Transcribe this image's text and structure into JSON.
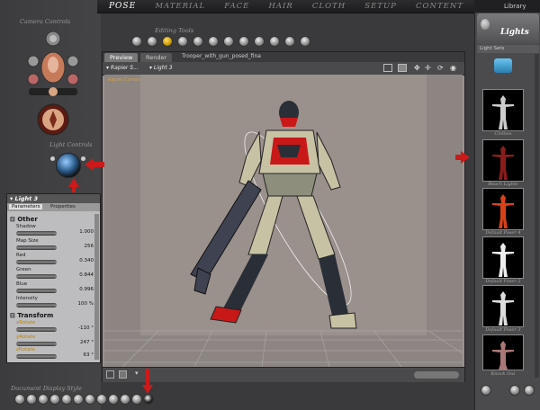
{
  "top_tabs": [
    "POSE",
    "MATERIAL",
    "FACE",
    "HAIR",
    "CLOTH",
    "SETUP",
    "CONTENT"
  ],
  "left": {
    "camera_controls_label": "Camera Controls",
    "light_controls_label": "Light Controls",
    "display_style_label": "Document Display Style"
  },
  "editing_tools_label": "Editing Tools",
  "document": {
    "tabs": [
      "Preview",
      "Render"
    ],
    "filename": "Trooper_with_gun_posed_fina",
    "camera_menu": "Rapier S...",
    "light_menu": "Light 3",
    "guide_label": "Rapier Camera"
  },
  "params": {
    "title": "Light 3",
    "tabs": [
      "Parameters",
      "Properties"
    ],
    "sections": [
      {
        "name": "Other",
        "rows": [
          {
            "name": "Shadow",
            "value": "1.000"
          },
          {
            "name": "Map Size",
            "value": "256"
          },
          {
            "name": "Red",
            "value": "0.340"
          },
          {
            "name": "Green",
            "value": "0.844"
          },
          {
            "name": "Blue",
            "value": "0.996"
          },
          {
            "name": "Intensity",
            "value": "100 %"
          }
        ]
      },
      {
        "name": "Transform",
        "rows": [
          {
            "name": "xRotate",
            "value": "-110 °"
          },
          {
            "name": "yRotate",
            "value": "247 °"
          },
          {
            "name": "zRotate",
            "value": "63 °"
          }
        ]
      }
    ]
  },
  "library": {
    "header": "Library",
    "title": "Lights",
    "subheader": "Light Sets",
    "items": [
      "Clothes",
      "Beach Lights",
      "Default Poser 4",
      "Default Poser 2",
      "Default Poser 3",
      "Knock Out"
    ]
  },
  "colors": {
    "accent_red": "#cc1a1a",
    "panel_bg": "#bdbcbe",
    "viewport_bg": "#8d8582"
  }
}
